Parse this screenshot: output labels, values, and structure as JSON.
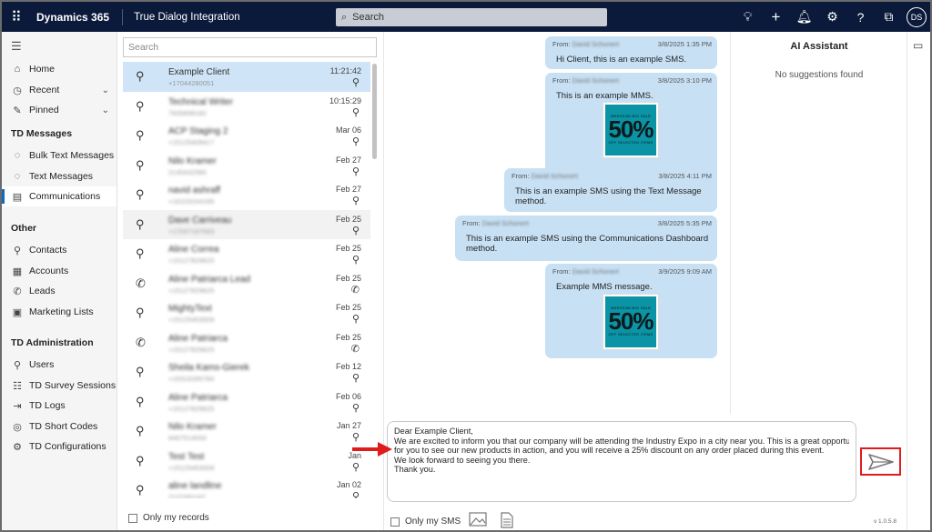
{
  "topbar": {
    "brand": "Dynamics 365",
    "app_name": "True Dialog Integration",
    "search_placeholder": "Search",
    "avatar_initials": "DS"
  },
  "sidebar": {
    "items": [
      {
        "label": "Home",
        "icon": "home-icon"
      },
      {
        "label": "Recent",
        "icon": "clock-icon",
        "chevron": "chevron-down-icon"
      },
      {
        "label": "Pinned",
        "icon": "pin-icon",
        "chevron": "chevron-down-icon"
      }
    ],
    "sections": [
      {
        "title": "TD Messages",
        "items": [
          "Bulk Text Messages",
          "Text Messages",
          "Communications"
        ]
      },
      {
        "title": "Other",
        "items": [
          "Contacts",
          "Accounts",
          "Leads",
          "Marketing Lists"
        ]
      },
      {
        "title": "TD Administration",
        "items": [
          "Users",
          "TD Survey Sessions",
          "TD Logs",
          "TD Short Codes",
          "TD Configurations"
        ]
      }
    ],
    "active_item": "Communications"
  },
  "contacts": {
    "search_placeholder": "Search",
    "only_my_records": "Only my records",
    "rows": [
      {
        "name": "Example Client",
        "phone": "+17044280051",
        "date": "11:21:42",
        "type": "person"
      },
      {
        "name": "Technical Writer",
        "phone": "7605898182",
        "date": "10:15:29",
        "type": "person"
      },
      {
        "name": "ACP Staging 2",
        "phone": "+15125408417",
        "date": "Mar 06",
        "type": "person"
      },
      {
        "name": "Nilo Kramer",
        "phone": "2145432580",
        "date": "Feb 27",
        "type": "person"
      },
      {
        "name": "navid ashraff",
        "phone": "+16103244185",
        "date": "Feb 27",
        "type": "person"
      },
      {
        "name": "Dave Carriveau",
        "phone": "+17047187693",
        "date": "Feb 25",
        "type": "person"
      },
      {
        "name": "Aline Correa",
        "phone": "+15127829625",
        "date": "Feb 25",
        "type": "person"
      },
      {
        "name": "Aline Patriarca Lead",
        "phone": "+15127829625",
        "date": "Feb 25",
        "type": "lead"
      },
      {
        "name": "MightyText",
        "phone": "+15125453009",
        "date": "Feb 25",
        "type": "person"
      },
      {
        "name": "Aline Patriarca",
        "phone": "+15127829625",
        "date": "Feb 25",
        "type": "lead"
      },
      {
        "name": "Sheila Kams-Gierek",
        "phone": "+16316285784",
        "date": "Feb 12",
        "type": "person"
      },
      {
        "name": "Aline Patriarca",
        "phone": "+15127829625",
        "date": "Feb 06",
        "type": "person"
      },
      {
        "name": "Nilo Kramer",
        "phone": "6467514034",
        "date": "Jan 27",
        "type": "person"
      },
      {
        "name": "Test Test",
        "phone": "+15125453009",
        "date": "Jan",
        "type": "person"
      },
      {
        "name": "aline landline",
        "phone": "2122391167",
        "date": "Jan 02",
        "type": "person"
      }
    ]
  },
  "messages": [
    {
      "from_label": "From:",
      "from_name": "David Schonert",
      "timestamp": "3/8/2025 1:35 PM",
      "text": [
        "Hi Client, this is an example SMS."
      ],
      "image": false
    },
    {
      "from_label": "From:",
      "from_name": "David Schonert",
      "timestamp": "3/8/2025 3:10 PM",
      "text": [
        "This is an example MMS."
      ],
      "image": true
    },
    {
      "from_label": "From:",
      "from_name": "David Schonert",
      "timestamp": "3/8/2025 4:11 PM",
      "text": [
        "This is an example SMS using the Text Message",
        "method."
      ],
      "image": false
    },
    {
      "from_label": "From:",
      "from_name": "David Schonert",
      "timestamp": "3/8/2025 5:35 PM",
      "text": [
        "This is an example SMS using the Communications Dashboard",
        "method."
      ],
      "image": false
    },
    {
      "from_label": "From:",
      "from_name": "David Schonert",
      "timestamp": "3/9/2025 9:09 AM",
      "text": [
        "Example MMS message."
      ],
      "image": true
    }
  ],
  "promo": {
    "top": "WEEKEND BIG SALE",
    "big": "50%",
    "bottom": "OFF SELECTED ITEMS"
  },
  "ai_assistant": {
    "title": "AI Assistant",
    "empty_text": "No suggestions found"
  },
  "compose": {
    "lines": [
      "Dear Example Client,",
      "We are excited to inform you that our company will be attending the Industry Expo in a city near you. This is a great opportunity",
      "for you to see our new products in action, and you will receive a 25% discount on any order placed during this event.",
      "We look forward to seeing you there.",
      "Thank you."
    ],
    "only_my_sms": "Only my SMS",
    "version": "v 1.0.5.8"
  },
  "colors": {
    "accent": "#0f6cbd",
    "topbar": "#0b1a3b",
    "bubble": "#c7e0f4",
    "highlight": "#e01b1b"
  }
}
